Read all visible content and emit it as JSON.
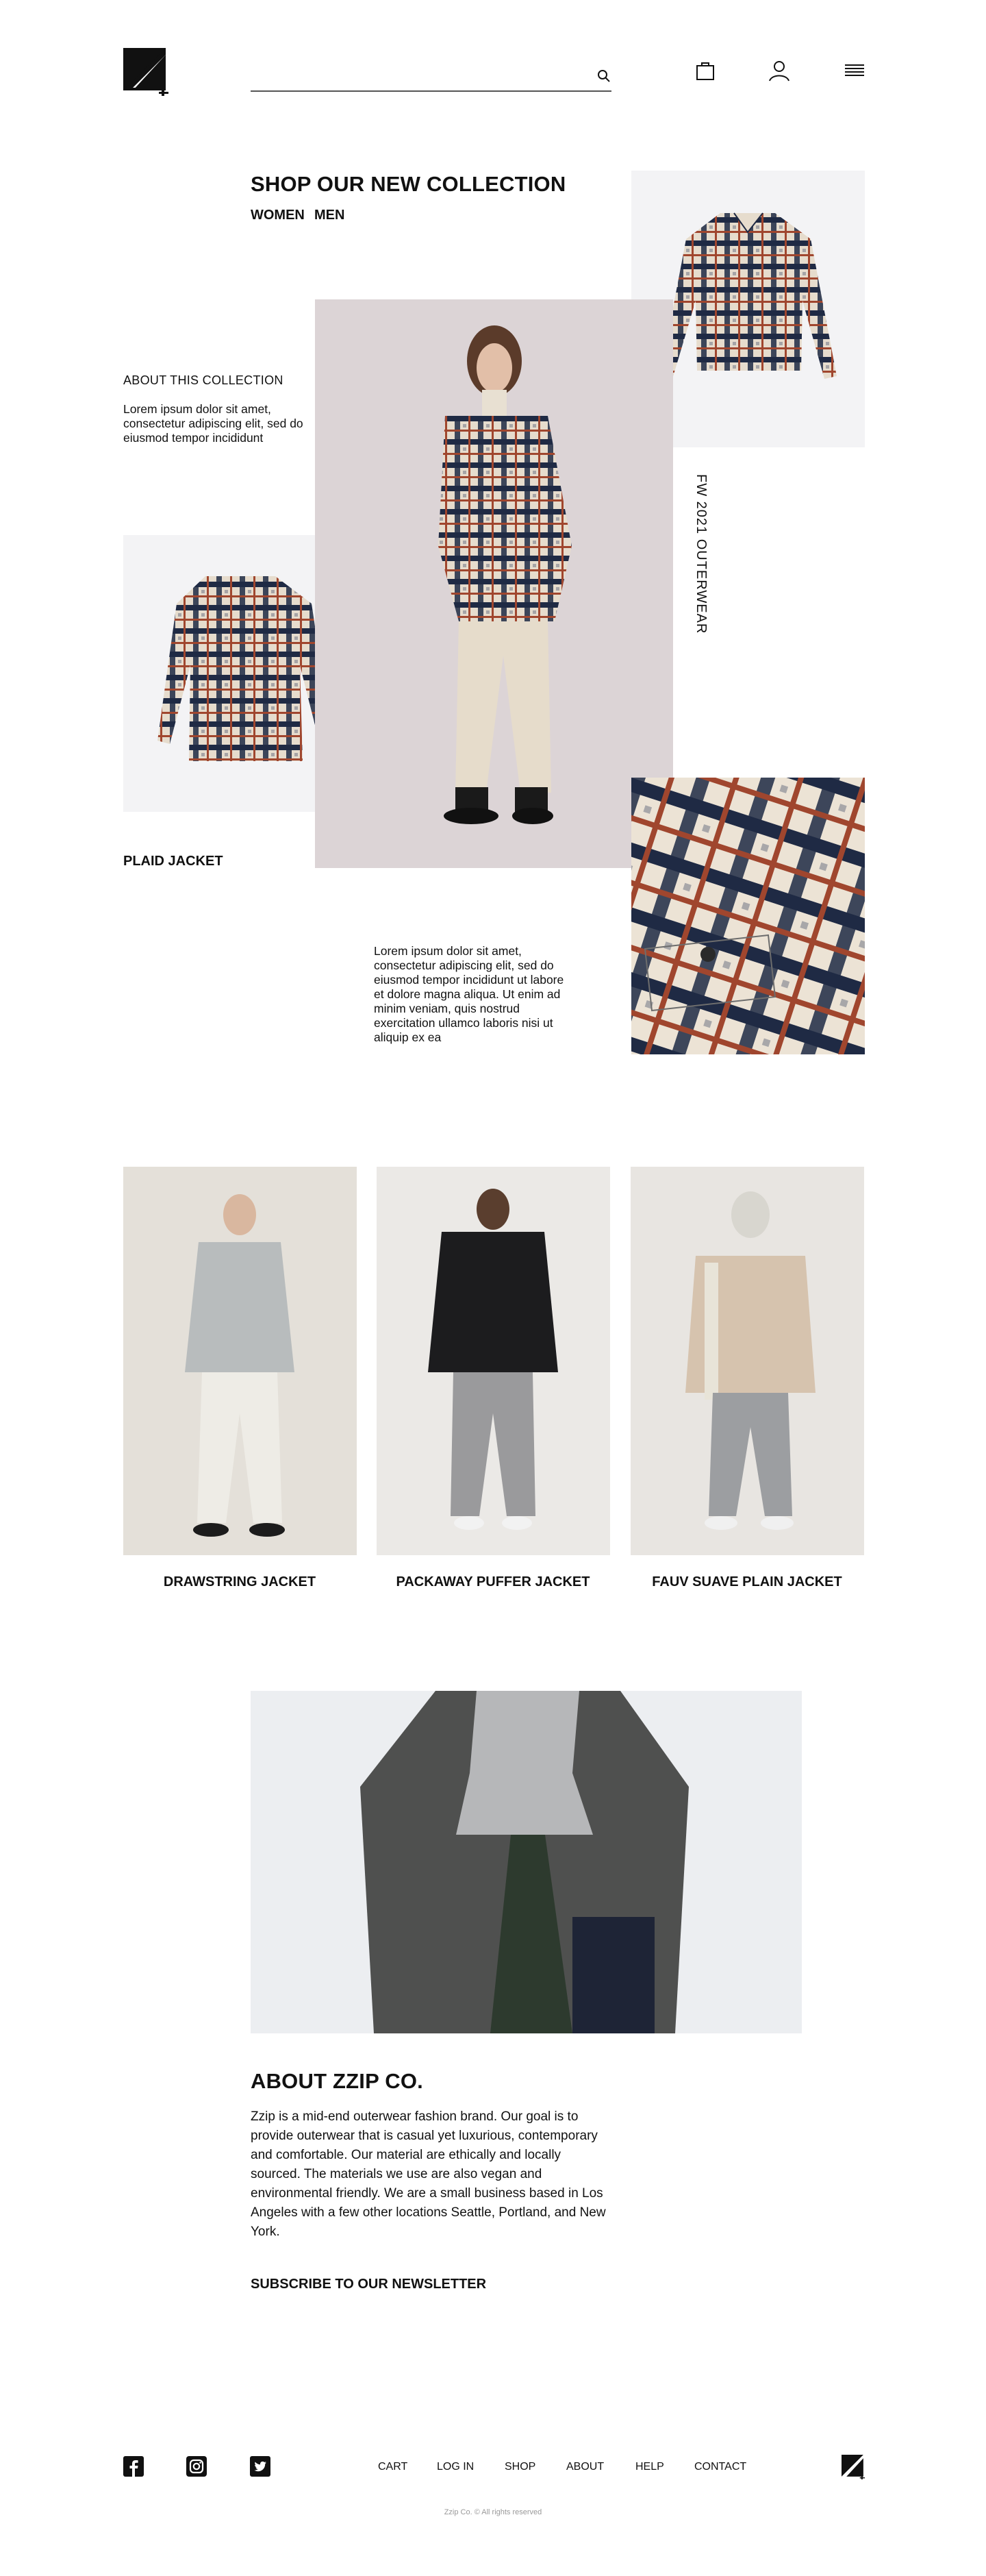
{
  "header": {
    "search": {
      "placeholder": "",
      "value": ""
    },
    "icons": [
      "logo-icon",
      "search-icon",
      "bag-icon",
      "user-icon",
      "menu-icon"
    ]
  },
  "collection": {
    "title": "SHOP OUR NEW COLLECTION",
    "tabs": [
      "WOMEN",
      "MEN"
    ],
    "about_heading": "ABOUT THIS COLLECTION",
    "about_text": "Lorem ipsum dolor sit amet, consectetur adipiscing elit, sed do eiusmod tempor incididunt",
    "side_label": "FW 2021 OUTERWEAR",
    "product_label": "PLAID JACKET",
    "description": "Lorem ipsum dolor sit amet, consectetur adipiscing elit, sed do eiusmod tempor incididunt ut labore et dolore magna aliqua. Ut enim ad minim veniam, quis nostrud exercitation ullamco laboris nisi ut aliquip ex ea"
  },
  "products": [
    {
      "name": "DRAWSTRING JACKET"
    },
    {
      "name": "PACKAWAY PUFFER JACKET"
    },
    {
      "name": "FAUV SUAVE PLAIN JACKET"
    }
  ],
  "about": {
    "title": "ABOUT ZZIP CO.",
    "text": "Zzip is a mid-end outerwear fashion brand. Our goal is to provide outerwear that is casual yet luxurious, contemporary and comfortable. Our material are ethically and locally sourced. The materials we use are also vegan and environmental friendly. We are a small business based in Los Angeles with a few other locations Seattle, Portland, and New York.",
    "newsletter": "SUBSCRIBE TO OUR NEWSLETTER"
  },
  "footer": {
    "social": [
      "facebook-icon",
      "instagram-icon",
      "twitter-icon"
    ],
    "links": [
      "CART",
      "LOG IN",
      "SHOP",
      "ABOUT",
      "HELP",
      "CONTACT"
    ],
    "copyright": "Zzip Co. © All rights reserved"
  },
  "colors": {
    "text": "#111111",
    "placeholder_bg": "#f3f3f5",
    "plaid_cream": "#e8dccb",
    "plaid_navy": "#1f2a44",
    "plaid_rust": "#a0462e"
  }
}
